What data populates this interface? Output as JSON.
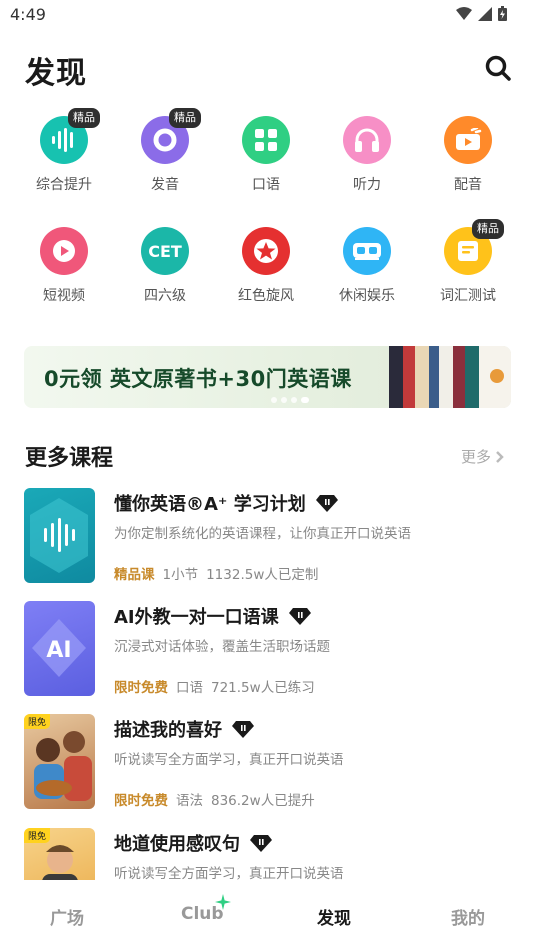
{
  "status": {
    "time": "4:49"
  },
  "header": {
    "title": "发现"
  },
  "grid": [
    {
      "label": "综合提升",
      "badge": "精品",
      "icon": "waveform-icon",
      "color": "#17c2b0"
    },
    {
      "label": "发音",
      "badge": "精品",
      "icon": "pronunciation-icon",
      "color": "#8b6ce8"
    },
    {
      "label": "口语",
      "badge": "",
      "icon": "grid-blocks-icon",
      "color": "#2fcf83"
    },
    {
      "label": "听力",
      "badge": "",
      "icon": "headphones-icon",
      "color": "#f78fc6"
    },
    {
      "label": "配音",
      "badge": "",
      "icon": "dubbing-icon",
      "color": "#ff8a2a"
    },
    {
      "label": "短视频",
      "badge": "",
      "icon": "play-icon",
      "color": "#f0577a"
    },
    {
      "label": "四六级",
      "badge": "",
      "icon": "cet-icon",
      "color": "#1bb7a8"
    },
    {
      "label": "红色旋风",
      "badge": "",
      "icon": "red-star-icon",
      "color": "#e53030"
    },
    {
      "label": "休闲娱乐",
      "badge": "",
      "icon": "vr-glasses-icon",
      "color": "#2fb5f5"
    },
    {
      "label": "词汇测试",
      "badge": "精品",
      "icon": "vocab-card-icon",
      "color": "#ffc21a"
    }
  ],
  "banner": {
    "text": "0元领 英文原著书+30门英语课"
  },
  "section": {
    "title": "更多课程",
    "more": "更多"
  },
  "courses": [
    {
      "title": "懂你英语®A⁺ 学习计划",
      "desc": "为你定制系统化的英语课程，让你真正开口说英语",
      "tag": "精品课",
      "meta1": "1小节",
      "meta2": "1132.5w人已定制",
      "thumb_badge": ""
    },
    {
      "title": "AI外教一对一口语课",
      "desc": "沉浸式对话体验，覆盖生活职场话题",
      "tag": "限时免费",
      "meta1": "口语",
      "meta2": "721.5w人已练习",
      "thumb_badge": ""
    },
    {
      "title": "描述我的喜好",
      "desc": "听说读写全方面学习，真正开口说英语",
      "tag": "限时免费",
      "meta1": "语法",
      "meta2": "836.2w人已提升",
      "thumb_badge": "限免"
    },
    {
      "title": "地道使用感叹句",
      "desc": "听说读写全方面学习，真正开口说英语",
      "tag": "",
      "meta1": "",
      "meta2": "",
      "thumb_badge": "限免"
    }
  ],
  "nav": [
    {
      "label": "广场"
    },
    {
      "label": "Club"
    },
    {
      "label": "发现"
    },
    {
      "label": "我的"
    }
  ]
}
